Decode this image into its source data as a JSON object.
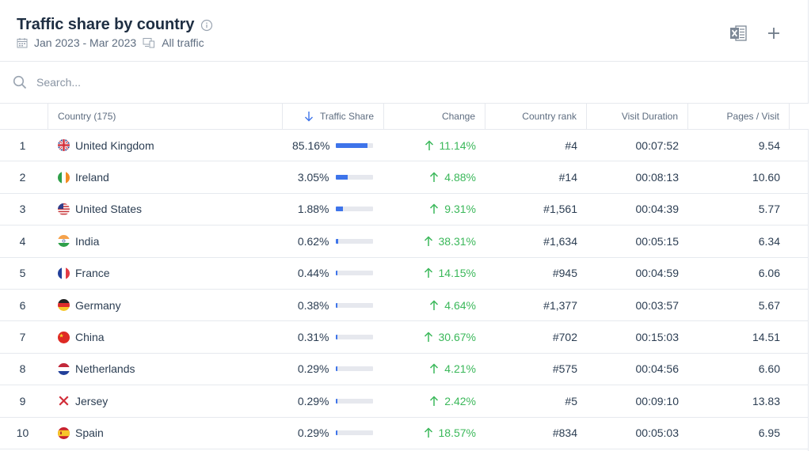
{
  "header": {
    "title": "Traffic share by country",
    "date_range": "Jan 2023 - Mar 2023",
    "traffic_type": "All traffic",
    "icons": [
      "info-icon",
      "calendar-icon",
      "devices-icon",
      "excel-icon",
      "plus-icon"
    ]
  },
  "search": {
    "placeholder": "Search..."
  },
  "table": {
    "columns": {
      "country": "Country (175)",
      "traffic_share": "Traffic Share",
      "change": "Change",
      "country_rank": "Country rank",
      "visit_duration": "Visit Duration",
      "pages_visit": "Pages / Visit"
    },
    "rows": [
      {
        "idx": "1",
        "country": "United Kingdom",
        "flag": "gb",
        "share": "85.16%",
        "share_frac": 0.8516,
        "change": "11.14%",
        "rank": "#4",
        "duration": "00:07:52",
        "pages": "9.54"
      },
      {
        "idx": "2",
        "country": "Ireland",
        "flag": "ie",
        "share": "3.05%",
        "share_frac": 0.0305,
        "change": "4.88%",
        "rank": "#14",
        "duration": "00:08:13",
        "pages": "10.60"
      },
      {
        "idx": "3",
        "country": "United States",
        "flag": "us",
        "share": "1.88%",
        "share_frac": 0.0188,
        "change": "9.31%",
        "rank": "#1,561",
        "duration": "00:04:39",
        "pages": "5.77"
      },
      {
        "idx": "4",
        "country": "India",
        "flag": "in",
        "share": "0.62%",
        "share_frac": 0.0062,
        "change": "38.31%",
        "rank": "#1,634",
        "duration": "00:05:15",
        "pages": "6.34"
      },
      {
        "idx": "5",
        "country": "France",
        "flag": "fr",
        "share": "0.44%",
        "share_frac": 0.0044,
        "change": "14.15%",
        "rank": "#945",
        "duration": "00:04:59",
        "pages": "6.06"
      },
      {
        "idx": "6",
        "country": "Germany",
        "flag": "de",
        "share": "0.38%",
        "share_frac": 0.0038,
        "change": "4.64%",
        "rank": "#1,377",
        "duration": "00:03:57",
        "pages": "5.67"
      },
      {
        "idx": "7",
        "country": "China",
        "flag": "cn",
        "share": "0.31%",
        "share_frac": 0.0031,
        "change": "30.67%",
        "rank": "#702",
        "duration": "00:15:03",
        "pages": "14.51"
      },
      {
        "idx": "8",
        "country": "Netherlands",
        "flag": "nl",
        "share": "0.29%",
        "share_frac": 0.0029,
        "change": "4.21%",
        "rank": "#575",
        "duration": "00:04:56",
        "pages": "6.60"
      },
      {
        "idx": "9",
        "country": "Jersey",
        "flag": "je",
        "share": "0.29%",
        "share_frac": 0.0029,
        "change": "2.42%",
        "rank": "#5",
        "duration": "00:09:10",
        "pages": "13.83"
      },
      {
        "idx": "10",
        "country": "Spain",
        "flag": "es",
        "share": "0.29%",
        "share_frac": 0.0029,
        "change": "18.57%",
        "rank": "#834",
        "duration": "00:05:03",
        "pages": "6.95"
      }
    ]
  },
  "colors": {
    "accent_blue": "#3e74ea",
    "positive_green": "#3bb85a",
    "title": "#1e2e42"
  }
}
